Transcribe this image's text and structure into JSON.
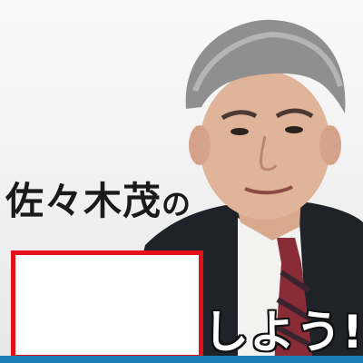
{
  "headline": {
    "name": "佐々木茂",
    "particle": "の"
  },
  "suffix": "しよう!",
  "colors": {
    "frame_red": "#e5101b",
    "bar_blue": "#1b7fb5"
  }
}
